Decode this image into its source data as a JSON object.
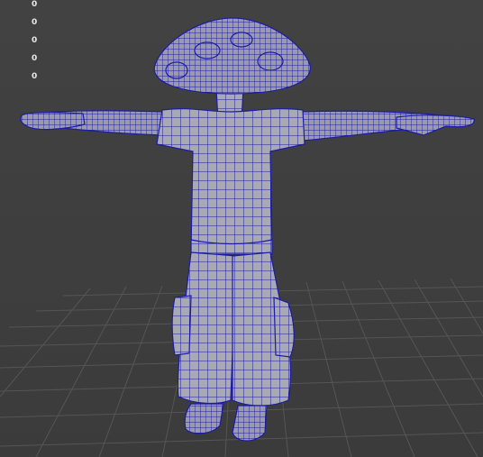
{
  "hud": {
    "values": [
      "0",
      "0",
      "0",
      "0",
      "0"
    ]
  },
  "colors": {
    "viewport_bg": "#3d3d3d",
    "grid_line": "#5a5a5a",
    "wireframe": "#1c1ca0",
    "mesh_fill": "#a9a9b3"
  }
}
